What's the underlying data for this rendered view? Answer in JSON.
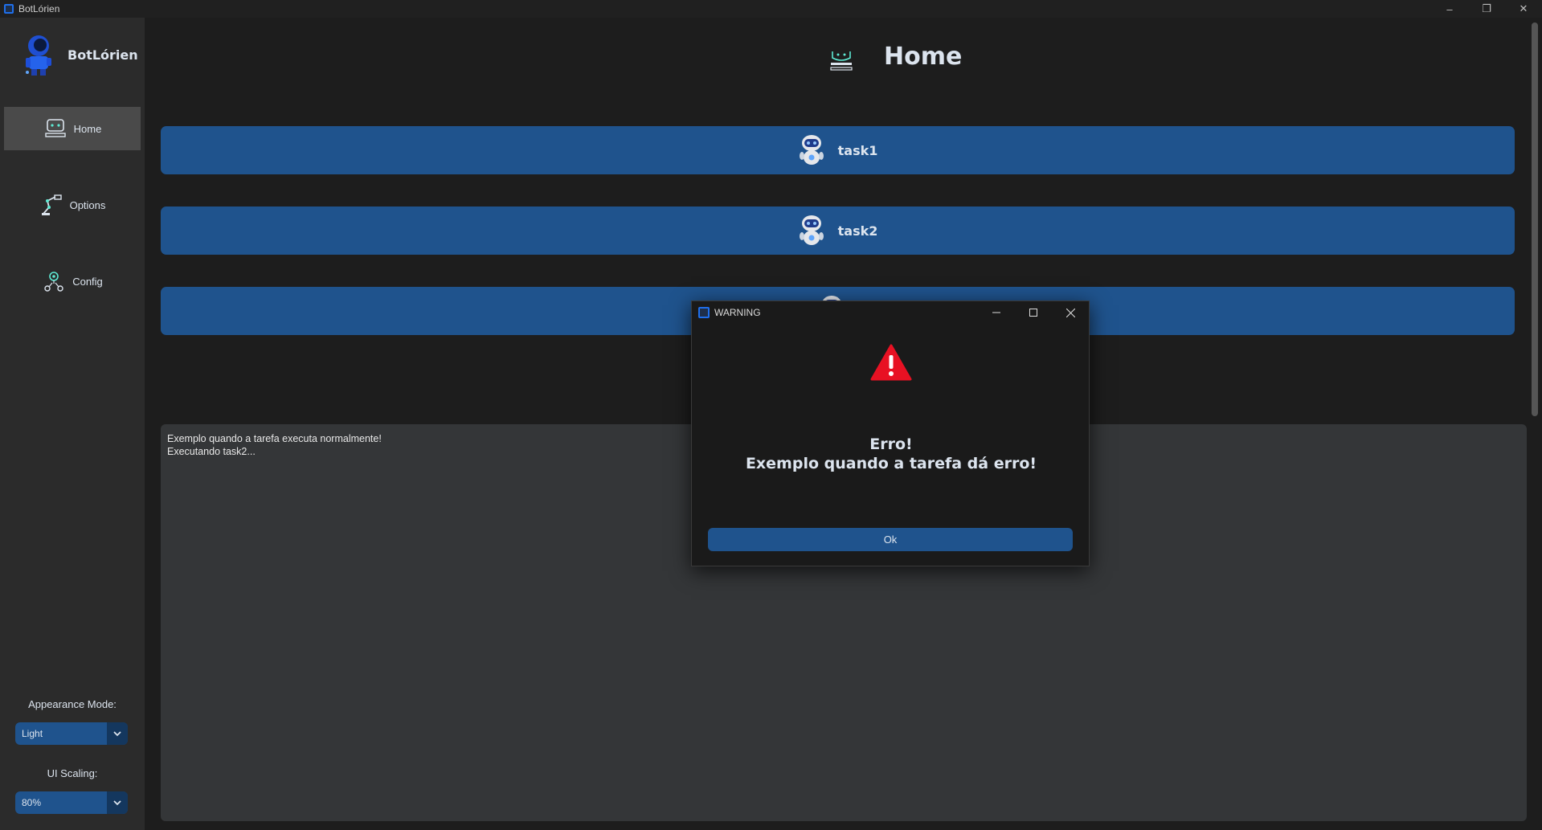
{
  "window": {
    "title": "BotLórien"
  },
  "sidebar": {
    "brand": "BotLórien",
    "items": [
      {
        "label": "Home",
        "icon": "robot-desk-icon",
        "active": true
      },
      {
        "label": "Options",
        "icon": "robot-arm-icon",
        "active": false
      },
      {
        "label": "Config",
        "icon": "gear-network-icon",
        "active": false
      }
    ],
    "appearance_label": "Appearance Mode:",
    "appearance_value": "Light",
    "scaling_label": "UI Scaling:",
    "scaling_value": "80%"
  },
  "main": {
    "title": "Home",
    "tasks": [
      {
        "label": "task1"
      },
      {
        "label": "task2"
      },
      {
        "label": ""
      }
    ],
    "console_lines": [
      "Exemplo quando a tarefa executa normalmente!",
      "Executando task2..."
    ]
  },
  "dialog": {
    "title": "WARNING",
    "message_line1": "Erro!",
    "message_line2": "Exemplo quando a tarefa dá erro!",
    "ok_label": "Ok"
  },
  "colors": {
    "accent": "#1f538d",
    "sidebar_bg": "#2b2b2b",
    "main_bg": "#1d1d1d",
    "warning": "#e81123"
  }
}
